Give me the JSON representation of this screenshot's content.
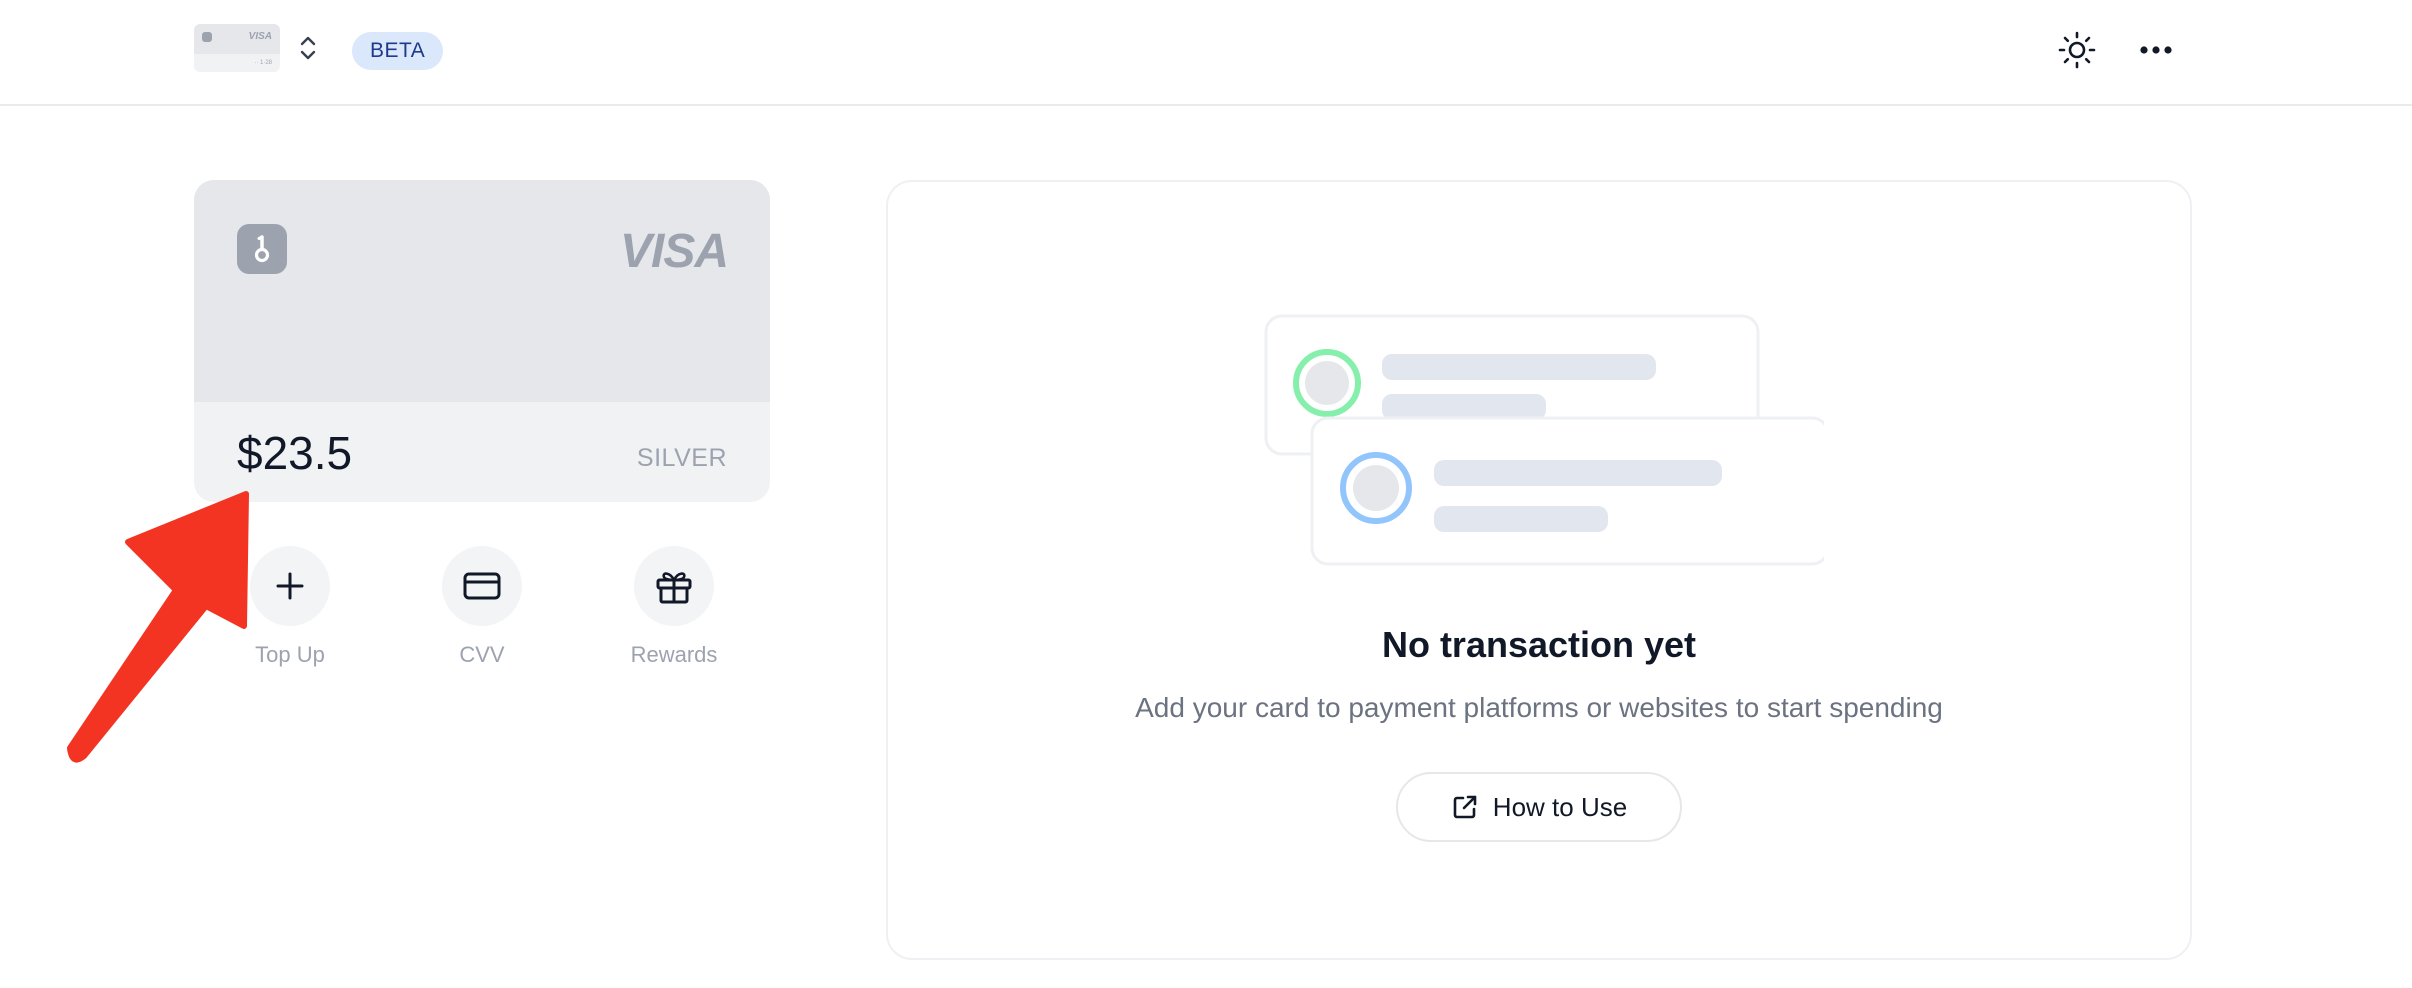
{
  "header": {
    "card_thumbnail": {
      "brand": "VISA",
      "number_mask": "·· 1·28"
    },
    "badge": "BETA",
    "icons": [
      "card-thumbnail",
      "chevron-up-down-icon",
      "sun-icon",
      "more-horizontal-icon"
    ]
  },
  "card": {
    "brand": "VISA",
    "balance": "$23.5",
    "tier": "SILVER"
  },
  "actions": [
    {
      "label": "Top Up",
      "icon": "plus-icon"
    },
    {
      "label": "CVV",
      "icon": "credit-card-icon"
    },
    {
      "label": "Rewards",
      "icon": "gift-icon"
    }
  ],
  "transactions": {
    "empty_title": "No transaction yet",
    "empty_subtitle": "Add your card to payment platforms or websites to start spending",
    "button_label": "How to Use",
    "button_icon": "external-link-icon"
  },
  "colors": {
    "accent_green": "#86efac",
    "accent_blue": "#93c5fd",
    "annotation_red": "#f33422",
    "badge_bg": "#dbe7fb"
  }
}
